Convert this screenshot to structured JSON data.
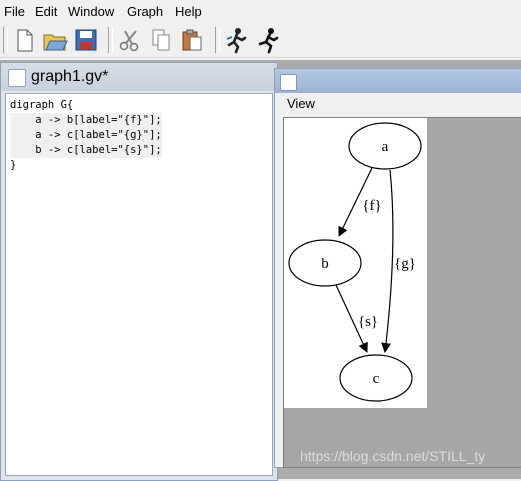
{
  "menu": {
    "items": [
      {
        "label": "File"
      },
      {
        "label": "Edit"
      },
      {
        "label": "Window"
      },
      {
        "label": "Graph"
      },
      {
        "label": "Help"
      }
    ]
  },
  "toolbar": {
    "buttons": [
      {
        "icon": "new-document-icon"
      },
      {
        "icon": "open-folder-icon"
      },
      {
        "icon": "save-disk-icon"
      },
      {
        "icon": "cut-scissors-icon"
      },
      {
        "icon": "copy-icon"
      },
      {
        "icon": "paste-icon"
      },
      {
        "icon": "run-layout-icon"
      },
      {
        "icon": "run-icon"
      }
    ]
  },
  "editor": {
    "title": "graph1.gv*",
    "lines": [
      "digraph G{",
      "    a -> b[label=\"{f}\"];",
      "    a -> c[label=\"{g}\"];",
      "    b -> c[label=\"{s}\"];",
      "}"
    ]
  },
  "viewer": {
    "menu_label": "View",
    "nodes": [
      {
        "id": "a",
        "label": "a"
      },
      {
        "id": "b",
        "label": "b"
      },
      {
        "id": "c",
        "label": "c"
      }
    ],
    "edges": [
      {
        "label": "{f}"
      },
      {
        "label": "{g}"
      },
      {
        "label": "{s}"
      }
    ]
  },
  "watermark": "https://blog.csdn.net/STILL_ty"
}
